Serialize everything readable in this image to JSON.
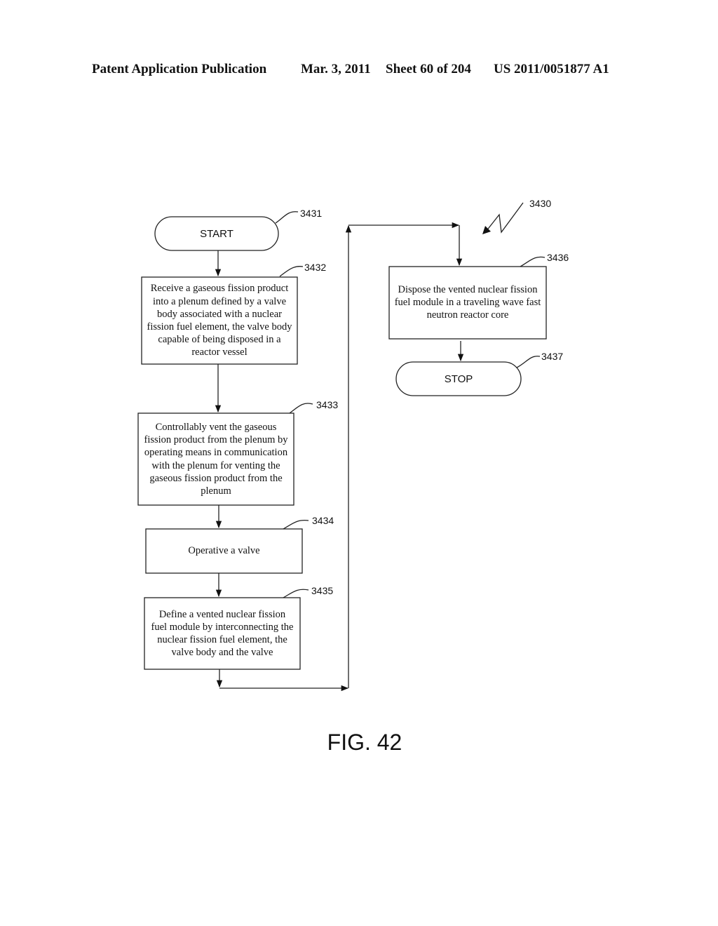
{
  "header": {
    "publication": "Patent Application Publication",
    "date": "Mar. 3, 2011",
    "sheet": "Sheet 60 of 204",
    "number": "US 2011/0051877 A1"
  },
  "figure": {
    "label": "FIG. 42",
    "ref": "3430"
  },
  "nodes": [
    {
      "id": "3431",
      "type": "terminal",
      "text": "START"
    },
    {
      "id": "3432",
      "type": "process",
      "text": "Receive a gaseous fission product into a plenum defined by a valve body associated with a nuclear fission fuel element, the valve body capable of being disposed in a reactor vessel"
    },
    {
      "id": "3433",
      "type": "process",
      "text": "Controllably vent the gaseous fission product from the plenum by operating means in communication with the plenum for venting the gaseous fission product from the plenum"
    },
    {
      "id": "3434",
      "type": "process",
      "text": "Operative a valve"
    },
    {
      "id": "3435",
      "type": "process",
      "text": "Define a vented nuclear fission fuel module by interconnecting the nuclear fission fuel element, the valve body and the valve"
    },
    {
      "id": "3436",
      "type": "process",
      "text": "Dispose the vented nuclear fission fuel module in a traveling wave fast neutron reactor core"
    },
    {
      "id": "3437",
      "type": "terminal",
      "text": "STOP"
    }
  ],
  "edges": [
    {
      "from": "3431",
      "to": "3432"
    },
    {
      "from": "3432",
      "to": "3433"
    },
    {
      "from": "3433",
      "to": "3434"
    },
    {
      "from": "3434",
      "to": "3435"
    },
    {
      "from": "3435",
      "to": "3436"
    },
    {
      "from": "3436",
      "to": "3437"
    }
  ]
}
